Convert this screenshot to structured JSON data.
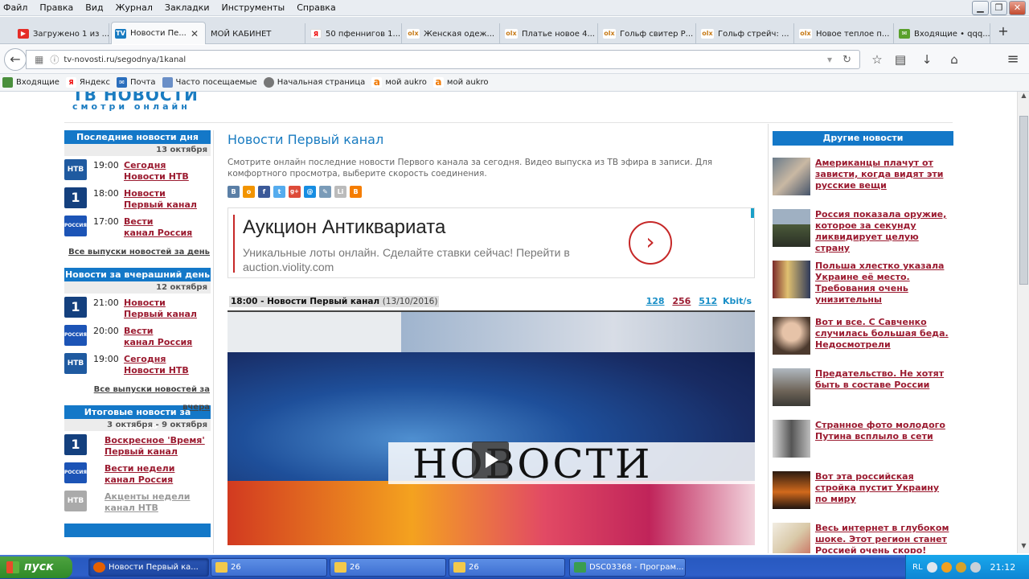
{
  "menu": [
    "Файл",
    "Правка",
    "Вид",
    "Журнал",
    "Закладки",
    "Инструменты",
    "Справка"
  ],
  "window_buttons": {
    "minimize": "▁",
    "maximize": "❐",
    "close": "✕"
  },
  "tabs": [
    {
      "label": "Загружено 1 из ...",
      "icon": "youtube-icon",
      "color": "#e52d27",
      "glyph": "▶"
    },
    {
      "label": "Новости Пе...",
      "icon": "tv-icon",
      "color": "#1a7cc1",
      "glyph": "TV"
    },
    {
      "label": "МОЙ КАБИНЕТ",
      "icon": "",
      "color": "",
      "glyph": ""
    },
    {
      "label": "50 пфеннигов 1...",
      "icon": "yandex-icon",
      "color": "#fff",
      "glyph": "Я"
    },
    {
      "label": "Женская одеж...",
      "icon": "olx-icon",
      "color": "#fff",
      "glyph": "olx"
    },
    {
      "label": "Платье новое 4...",
      "icon": "olx-icon",
      "color": "#fff",
      "glyph": "olx"
    },
    {
      "label": "Гольф свитер Р...",
      "icon": "olx-icon",
      "color": "#fff",
      "glyph": "olx"
    },
    {
      "label": "Гольф стрейч: ...",
      "icon": "olx-icon",
      "color": "#fff",
      "glyph": "olx"
    },
    {
      "label": "Новое теплое п...",
      "icon": "olx-icon",
      "color": "#fff",
      "glyph": "olx"
    },
    {
      "label": "Входящие • qqq...",
      "icon": "mail-icon",
      "color": "#5aa02c",
      "glyph": "✉"
    }
  ],
  "tab_close": "✕",
  "newtab": "+",
  "url": "tv-novosti.ru/segodnya/1kanal",
  "nav": {
    "back": "←",
    "info": "ⓘ",
    "dropdown": "▾",
    "reload": "↻",
    "star": "☆",
    "library": "▤",
    "download": "↓",
    "home": "⌂",
    "menu": "≡"
  },
  "bookmarks": [
    "Входящие",
    "Яндекс",
    "Почта",
    "Часто посещаемые",
    "Начальная страница",
    "мой aukro",
    "мой aukro"
  ],
  "logo": {
    "title": "ТВ НОВОСТИ",
    "tagline": "смотри онлайн"
  },
  "left": {
    "sections": [
      {
        "title": "Последние новости дня",
        "date": "13 октября",
        "items": [
          {
            "channel": "НТВ",
            "time": "19:00",
            "line1": "Сегодня",
            "line2": "Новости НТВ"
          },
          {
            "channel": "1",
            "time": "18:00",
            "line1": "Новости",
            "line2": "Первый канал"
          },
          {
            "channel": "РОССИЯ 1",
            "time": "17:00",
            "line1": "Вести",
            "line2": "канал Россия"
          }
        ],
        "all": "Все выпуски новостей за день"
      },
      {
        "title": "Новости за вчерашний день",
        "date": "12 октября",
        "items": [
          {
            "channel": "1",
            "time": "21:00",
            "line1": "Новости",
            "line2": "Первый канал"
          },
          {
            "channel": "РОССИЯ 1",
            "time": "20:00",
            "line1": "Вести",
            "line2": "канал Россия"
          },
          {
            "channel": "НТВ",
            "time": "19:00",
            "line1": "Сегодня",
            "line2": "Новости НТВ"
          }
        ],
        "all": "Все выпуски новостей за вчера"
      },
      {
        "title": "Итоговые новости за неделю",
        "date": "3 октября - 9 октября",
        "items": [
          {
            "channel": "1",
            "line1": "Воскресное 'Время'",
            "line2": "Первый канал"
          },
          {
            "channel": "РОССИЯ 1",
            "line1": "Вести недели",
            "line2": "канал Россия"
          },
          {
            "channel": "НТВ",
            "line1": "Акценты недели",
            "line2": "канал НТВ"
          }
        ]
      }
    ]
  },
  "center": {
    "title": "Новости Первый канал",
    "description": "Смотрите онлайн последние новости Первого канала за сегодня. Видео выпуска из ТВ эфира в записи. Для комфортного просмотра, выберите скорость соединения.",
    "shares": [
      {
        "name": "vk-icon",
        "glyph": "В",
        "color": "#5b7fa6"
      },
      {
        "name": "odnoklassniki-icon",
        "glyph": "о",
        "color": "#f29400"
      },
      {
        "name": "facebook-icon",
        "glyph": "f",
        "color": "#3b5998"
      },
      {
        "name": "twitter-icon",
        "glyph": "t",
        "color": "#55acee"
      },
      {
        "name": "googleplus-icon",
        "glyph": "g+",
        "color": "#dd4b39"
      },
      {
        "name": "moimir-icon",
        "glyph": "@",
        "color": "#168de2"
      },
      {
        "name": "livejournal-icon",
        "glyph": "✎",
        "color": "#7a9bb8"
      },
      {
        "name": "liveinternet-icon",
        "glyph": "Li",
        "color": "#bbbbbb"
      },
      {
        "name": "blogger-icon",
        "glyph": "B",
        "color": "#f57d00"
      }
    ],
    "ad": {
      "title": "Аукцион Антиквариата",
      "sub1": "Уникальные лоты онлайн. Сделайте ставки сейчас!",
      "link": "Перейти в",
      "sub2": "auction.violity.com",
      "arrow": "›"
    },
    "video": {
      "time_title": "18:00 - Новости Первый канал",
      "date": "(13/10/2016)",
      "speeds": [
        "128",
        "256",
        "512"
      ],
      "unit": "Kbit/s",
      "overlay": "НОВОСТИ"
    }
  },
  "right": {
    "title": "Другие новости",
    "items": [
      "Американцы плачут от зависти, когда видят эти русские вещи",
      "Россия показала оружие, которое за секунду ликвидирует целую страну",
      "Польша хлестко указала Украине её место. Требования очень унизительны",
      "Вот и все. С Савченко случилась большая беда. Недосмотрели",
      "Предательство. Не хотят быть в составе России",
      "Странное фото молодого Путина всплыло в сети",
      "Вот эта российская стройка пустит Украину по миру",
      "Весь интернет в глубоком шоке. Этот регион станет Россией очень скоро!"
    ]
  },
  "taskbar": {
    "start": "пуск",
    "items": [
      {
        "label": "Новости Первый ка...",
        "icon": "firefox-icon",
        "color": "#e66000"
      },
      {
        "label": "26",
        "icon": "folder-icon",
        "color": "#f3c94b"
      },
      {
        "label": "26",
        "icon": "folder-icon",
        "color": "#f3c94b"
      },
      {
        "label": "26",
        "icon": "folder-icon",
        "color": "#f3c94b"
      },
      {
        "label": "DSC03368 - Програм...",
        "icon": "image-viewer-icon",
        "color": "#3a9d4f"
      }
    ],
    "lang": "RL",
    "clock": "21:12"
  }
}
